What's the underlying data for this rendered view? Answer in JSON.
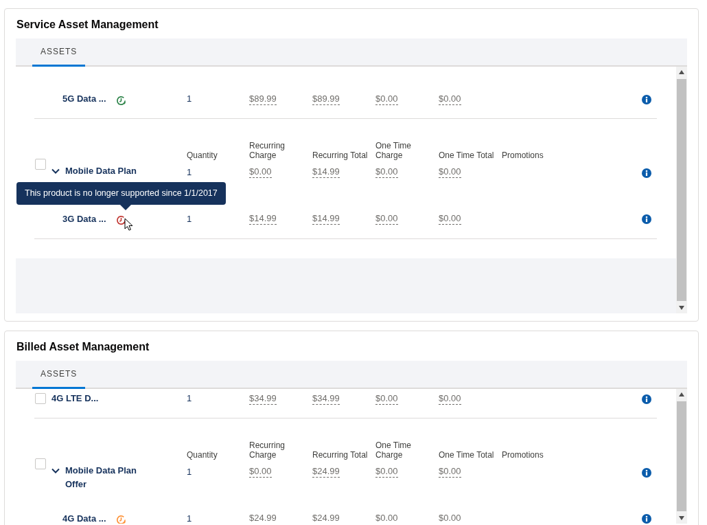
{
  "panels": [
    {
      "title": "Service Asset Management",
      "tabs": [
        {
          "label": "ASSETS",
          "selected": true
        }
      ],
      "rows": [
        {
          "kind": "child",
          "name": "5G Data ...",
          "color": "#2e844a",
          "quantity": "1",
          "recurring_charge": "$89.99",
          "recurring_total": "$89.99",
          "one_time_charge": "$0.00",
          "one_time_total": "$0.00"
        },
        {
          "kind": "group",
          "checked": false,
          "expanded": true,
          "name": "Mobile Data Plan",
          "columns": [
            "Quantity",
            "Recurring Charge",
            "Recurring Total",
            "One Time Charge",
            "One Time Total",
            "Promotions"
          ],
          "quantity": "1",
          "recurring_charge": "$0.00",
          "recurring_total": "$14.99",
          "one_time_charge": "$0.00",
          "one_time_total": "$0.00",
          "children": [
            {
              "kind": "child",
              "name": "3G Data ...",
              "color": "#c23934",
              "hovered": true,
              "tooltip": "This product is no longer supported since 1/1/2017",
              "quantity": "1",
              "recurring_charge": "$14.99",
              "recurring_total": "$14.99",
              "one_time_charge": "$0.00",
              "one_time_total": "$0.00"
            }
          ]
        }
      ]
    },
    {
      "title": "Billed Asset Management",
      "tabs": [
        {
          "label": "ASSETS",
          "selected": true
        }
      ],
      "rows": [
        {
          "kind": "line",
          "checked": false,
          "name": "4G LTE D...",
          "quantity": "1",
          "recurring_charge": "$34.99",
          "recurring_total": "$34.99",
          "one_time_charge": "$0.00",
          "one_time_total": "$0.00"
        },
        {
          "kind": "group",
          "checked": false,
          "expanded": true,
          "name": "Mobile Data Plan Offer",
          "columns": [
            "Quantity",
            "Recurring Charge",
            "Recurring Total",
            "One Time Charge",
            "One Time Total",
            "Promotions"
          ],
          "quantity": "1",
          "recurring_charge": "$0.00",
          "recurring_total": "$24.99",
          "one_time_charge": "$0.00",
          "one_time_total": "$0.00",
          "children": [
            {
              "kind": "child",
              "name": "4G Data ...",
              "color": "#fe9339",
              "quantity": "1",
              "recurring_charge": "$24.99",
              "recurring_total": "$24.99",
              "one_time_charge": "$0.00",
              "one_time_total": "$0.00"
            }
          ]
        }
      ]
    }
  ]
}
